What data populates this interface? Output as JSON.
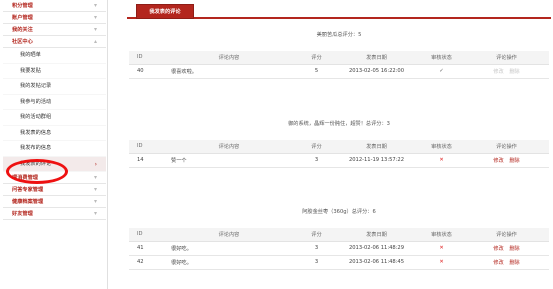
{
  "sidebar": {
    "top_sections": [
      {
        "label": "积分管理"
      },
      {
        "label": "账户管理"
      },
      {
        "label": "我的关注"
      }
    ],
    "community": {
      "label": "社区中心",
      "items": [
        {
          "label": "我的晒单"
        },
        {
          "label": "我要发贴"
        },
        {
          "label": "我的发帖记录"
        },
        {
          "label": "我参与的活动"
        },
        {
          "label": "我的活动群组"
        },
        {
          "label": "我发表的信息"
        },
        {
          "label": "我发布的信息"
        },
        {
          "label": "我发表的评论"
        }
      ]
    },
    "bottom_sections": [
      {
        "label": "理消费管理"
      },
      {
        "label": "问答专家管理"
      },
      {
        "label": "健康档案管理"
      },
      {
        "label": "好友管理"
      }
    ],
    "arrow": "›"
  },
  "tab": {
    "label": "我发表的评论"
  },
  "columns": [
    "ID",
    "评论内容",
    "评分",
    "发表日期",
    "审核状态",
    "评论操作"
  ],
  "groups": [
    {
      "caption": "美丽苦瓜总评分：5",
      "rows": [
        {
          "id": "40",
          "content": "很喜欢啦。",
          "score": "5",
          "date": "2013-02-05 16:22:00",
          "status": "✓",
          "status_type": "ok",
          "modify": "修改",
          "delete": "删除",
          "actions_disabled": true
        }
      ]
    },
    {
      "caption": "御的系统，晶辉一份肫住，超赞！总评分：3",
      "rows": [
        {
          "id": "14",
          "content": "赞一个",
          "score": "3",
          "date": "2012-11-19 13:57:22",
          "status": "✕",
          "status_type": "no",
          "modify": "修改",
          "delete": "删除",
          "actions_disabled": false
        }
      ]
    },
    {
      "caption": "阿胶金丝枣（360g）总评分：6",
      "rows": [
        {
          "id": "41",
          "content": "很好吃。",
          "score": "3",
          "date": "2013-02-06 11:48:29",
          "status": "✕",
          "status_type": "no",
          "modify": "修改",
          "delete": "删除",
          "actions_disabled": false
        },
        {
          "id": "42",
          "content": "很好吃。",
          "score": "3",
          "date": "2013-02-06 11:48:45",
          "status": "✕",
          "status_type": "no",
          "modify": "修改",
          "delete": "删除",
          "actions_disabled": false
        }
      ]
    }
  ],
  "colors": {
    "accent": "#b3261e",
    "highlight_oval": "#e11111",
    "reject": "#e02020"
  }
}
